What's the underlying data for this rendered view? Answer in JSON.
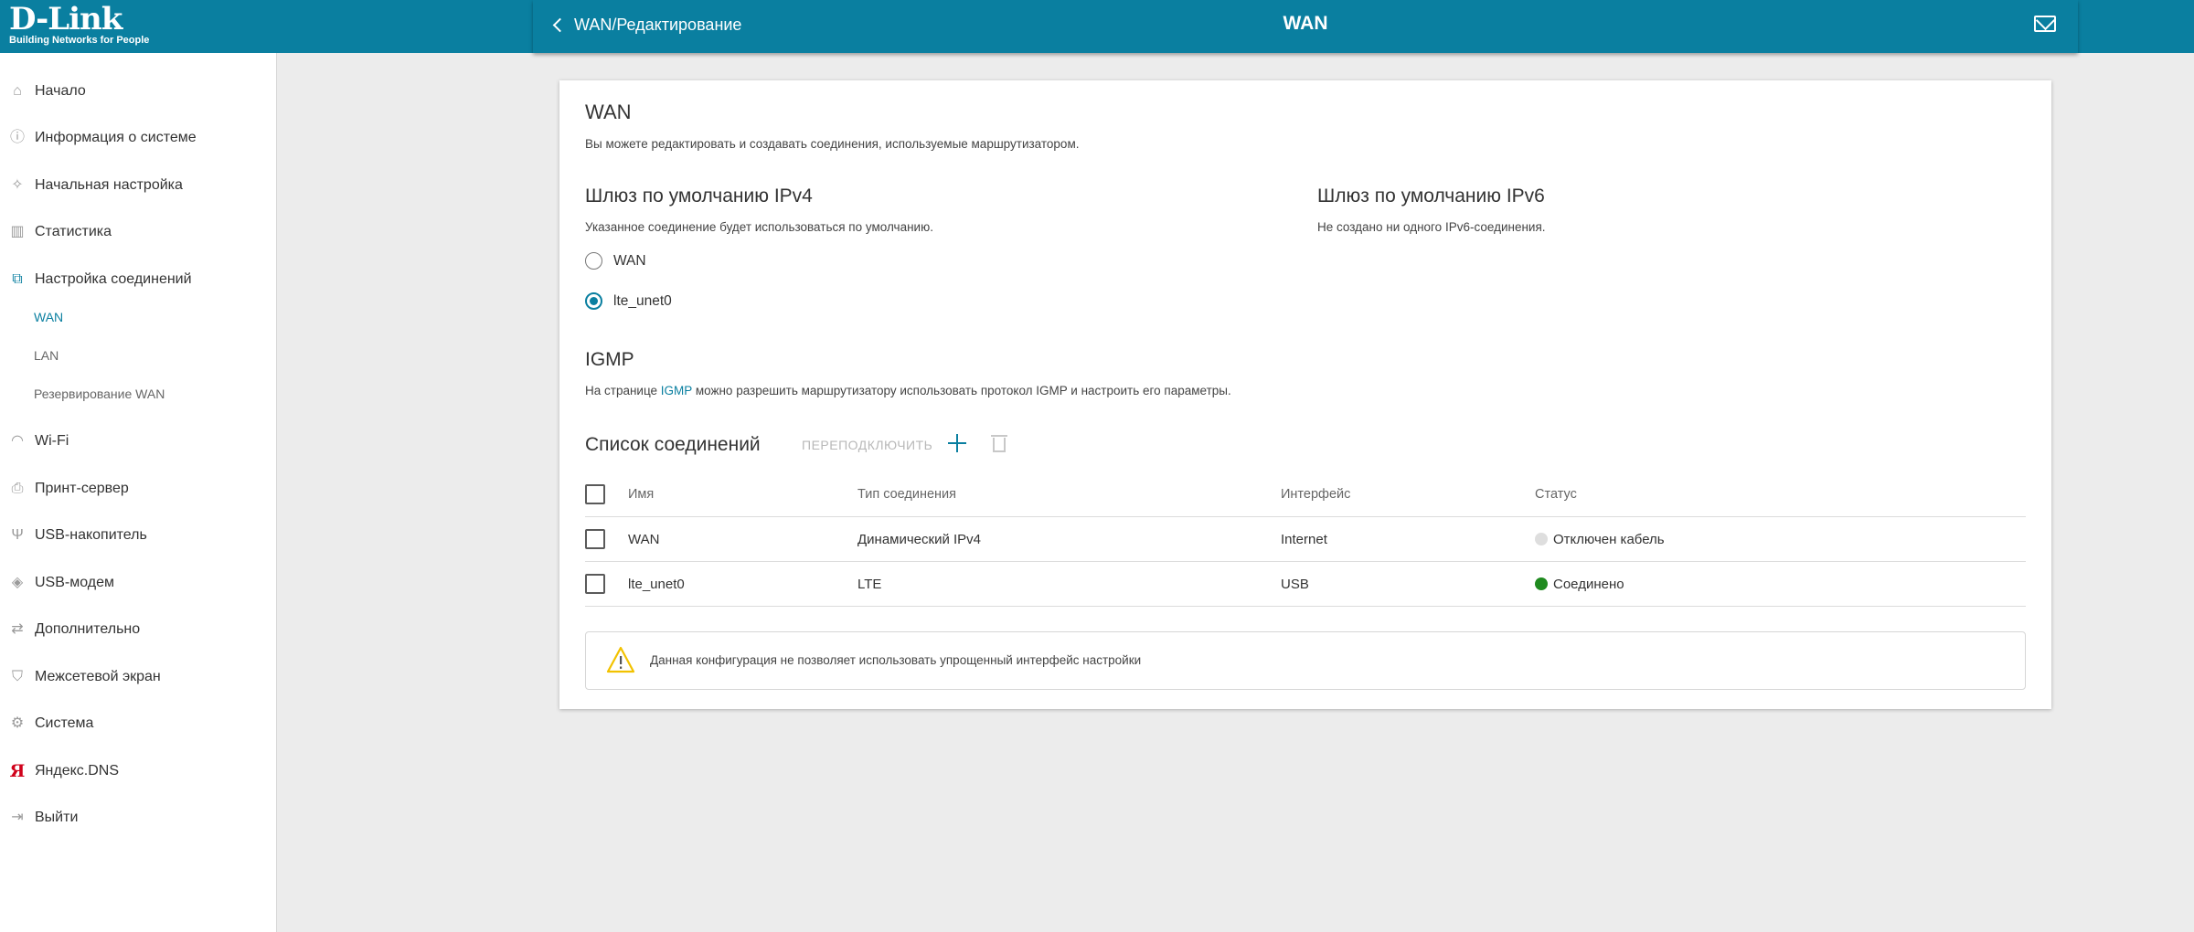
{
  "brand": {
    "name": "D-Link",
    "tagline": "Building Networks for People"
  },
  "header": {
    "back_label": "WAN/Редактирование",
    "title": "WAN"
  },
  "sidebar": {
    "items": [
      {
        "label": "Начало",
        "icon": "home-icon"
      },
      {
        "label": "Информация о системе",
        "icon": "info-icon"
      },
      {
        "label": "Начальная настройка",
        "icon": "wand-icon"
      },
      {
        "label": "Статистика",
        "icon": "stats-icon"
      },
      {
        "label": "Настройка соединений",
        "icon": "connections-icon"
      },
      {
        "label": "Wi-Fi",
        "icon": "wifi-icon"
      },
      {
        "label": "Принт-сервер",
        "icon": "printer-icon"
      },
      {
        "label": "USB-накопитель",
        "icon": "usb-icon"
      },
      {
        "label": "USB-модем",
        "icon": "modem-icon"
      },
      {
        "label": "Дополнительно",
        "icon": "advanced-icon"
      },
      {
        "label": "Межсетевой экран",
        "icon": "shield-icon"
      },
      {
        "label": "Система",
        "icon": "gear-icon"
      },
      {
        "label": "Яндекс.DNS",
        "icon": "yandex-icon"
      },
      {
        "label": "Выйти",
        "icon": "logout-icon"
      }
    ],
    "subitems": [
      {
        "label": "WAN",
        "active": true
      },
      {
        "label": "LAN",
        "active": false
      },
      {
        "label": "Резервирование WAN",
        "active": false
      }
    ]
  },
  "main": {
    "title": "WAN",
    "description": "Вы можете редактировать и создавать соединения, используемые маршрутизатором.",
    "ipv4": {
      "title": "Шлюз по умолчанию IPv4",
      "description": "Указанное соединение будет использоваться по умолчанию.",
      "options": [
        {
          "label": "WAN",
          "checked": false
        },
        {
          "label": "lte_unet0",
          "checked": true
        }
      ]
    },
    "ipv6": {
      "title": "Шлюз по умолчанию IPv6",
      "description": "Не создано ни одного IPv6-соединения."
    },
    "igmp": {
      "title": "IGMP",
      "text_before": "На странице ",
      "link": "IGMP",
      "text_after": " можно разрешить маршрутизатору использовать протокол IGMP и настроить его параметры."
    },
    "connections": {
      "title": "Список соединений",
      "reconnect_label": "ПЕРЕПОДКЛЮЧИТЬ",
      "headers": [
        "Имя",
        "Тип соединения",
        "Интерфейс",
        "Статус"
      ],
      "rows": [
        {
          "name": "WAN",
          "type": "Динамический IPv4",
          "interface": "Internet",
          "status": "Отключен кабель",
          "status_color": "#dedede"
        },
        {
          "name": "lte_unet0",
          "type": "LTE",
          "interface": "USB",
          "status": "Соединено",
          "status_color": "#1f8a1f"
        }
      ]
    },
    "alert": {
      "text": "Данная конфигурация не позволяет использовать упрощенный интерфейс настройки",
      "icon": "warning-icon"
    }
  },
  "colors": {
    "accent": "#0a7fa0",
    "warning": "#f2c200"
  }
}
